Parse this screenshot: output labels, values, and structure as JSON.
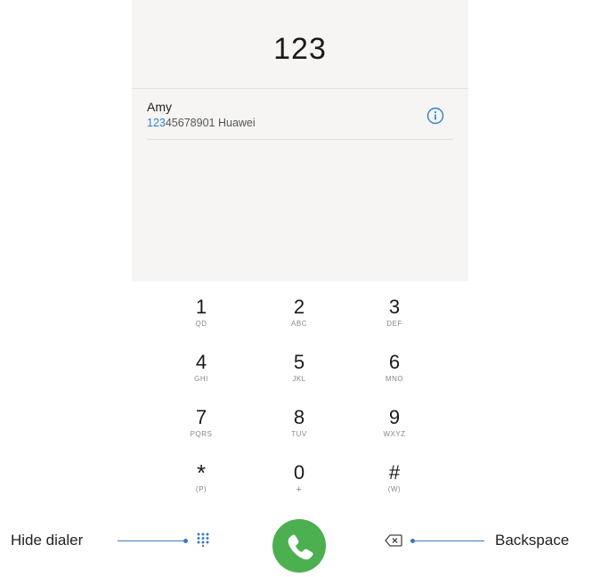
{
  "search": {
    "dialed": "123"
  },
  "contact": {
    "name": "Amy",
    "number_match": "123",
    "number_rest": "45678901",
    "carrier": "Huawei"
  },
  "keypad": {
    "keys": [
      {
        "digit": "1",
        "sub": "QD"
      },
      {
        "digit": "2",
        "sub": "ABC"
      },
      {
        "digit": "3",
        "sub": "DEF"
      },
      {
        "digit": "4",
        "sub": "GHI"
      },
      {
        "digit": "5",
        "sub": "JKL"
      },
      {
        "digit": "6",
        "sub": "MNO"
      },
      {
        "digit": "7",
        "sub": "PQRS"
      },
      {
        "digit": "8",
        "sub": "TUV"
      },
      {
        "digit": "9",
        "sub": "WXYZ"
      },
      {
        "digit": "*",
        "sub": "(P)"
      },
      {
        "digit": "0",
        "sub": "+"
      },
      {
        "digit": "#",
        "sub": "(W)"
      }
    ]
  },
  "callouts": {
    "hide_dialer": "Hide dialer",
    "backspace": "Backspace"
  },
  "colors": {
    "call_button": "#4caf50",
    "match_highlight": "#2f7fcf",
    "info_icon": "#2f7fcf",
    "leader_line": "#3a7bbf"
  },
  "icons": [
    "info-icon",
    "dialpad-icon",
    "phone-icon",
    "backspace-icon"
  ]
}
